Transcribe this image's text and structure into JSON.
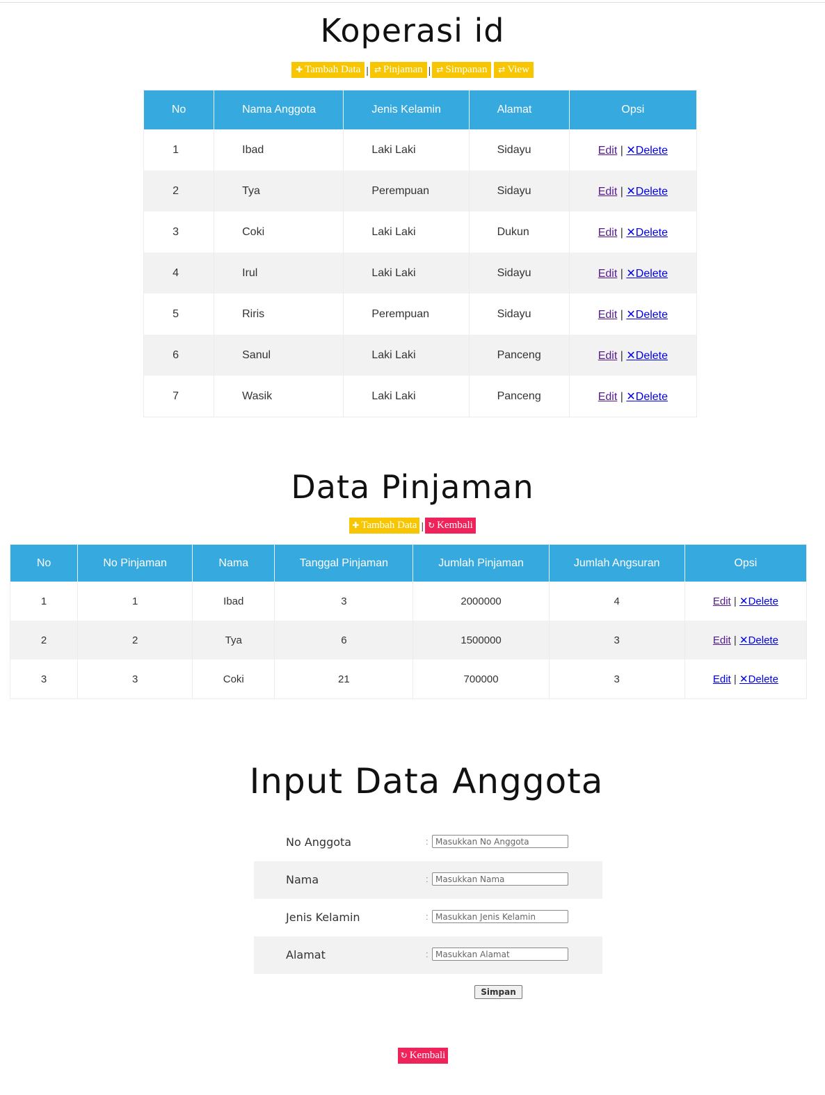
{
  "anggota_section": {
    "title": "Koperasi id",
    "buttons": {
      "tambah": "Tambah Data",
      "pinjaman": "Pinjaman",
      "simpanan": "Simpanan",
      "view": "View"
    },
    "separator": "|",
    "headers": [
      "No",
      "Nama Anggota",
      "Jenis Kelamin",
      "Alamat",
      "Opsi"
    ],
    "rows": [
      {
        "no": "1",
        "nama": "Ibad",
        "jk": "Laki Laki",
        "alamat": "Sidayu"
      },
      {
        "no": "2",
        "nama": "Tya",
        "jk": "Perempuan",
        "alamat": "Sidayu"
      },
      {
        "no": "3",
        "nama": "Coki",
        "jk": "Laki Laki",
        "alamat": "Dukun"
      },
      {
        "no": "4",
        "nama": "Irul",
        "jk": "Laki Laki",
        "alamat": "Sidayu"
      },
      {
        "no": "5",
        "nama": "Riris",
        "jk": "Perempuan",
        "alamat": "Sidayu"
      },
      {
        "no": "6",
        "nama": "Sanul",
        "jk": "Laki Laki",
        "alamat": "Panceng"
      },
      {
        "no": "7",
        "nama": "Wasik",
        "jk": "Laki Laki",
        "alamat": "Panceng"
      }
    ],
    "edit_label": "Edit",
    "delete_label": "Delete"
  },
  "pinjaman_section": {
    "title": "Data Pinjaman",
    "buttons": {
      "tambah": "Tambah Data",
      "kembali": "Kembali"
    },
    "separator": "|",
    "headers": [
      "No",
      "No Pinjaman",
      "Nama",
      "Tanggal Pinjaman",
      "Jumlah Pinjaman",
      "Jumlah Angsuran",
      "Opsi"
    ],
    "rows": [
      {
        "no": "1",
        "no_pinjaman": "1",
        "nama": "Ibad",
        "tanggal": "3",
        "jumlah": "2000000",
        "angsuran": "4"
      },
      {
        "no": "2",
        "no_pinjaman": "2",
        "nama": "Tya",
        "tanggal": "6",
        "jumlah": "1500000",
        "angsuran": "3"
      },
      {
        "no": "3",
        "no_pinjaman": "3",
        "nama": "Coki",
        "tanggal": "21",
        "jumlah": "700000",
        "angsuran": "3"
      }
    ],
    "edit_label": "Edit",
    "delete_label": "Delete"
  },
  "form_section": {
    "title": "Input Data Anggota",
    "fields": [
      {
        "label": "No Anggota",
        "placeholder": "Masukkan No Anggota"
      },
      {
        "label": "Nama",
        "placeholder": "Masukkan Nama"
      },
      {
        "label": "Jenis Kelamin",
        "placeholder": "Masukkan Jenis Kelamin"
      },
      {
        "label": "Alamat",
        "placeholder": "Masukkan Alamat"
      }
    ],
    "colon": ":",
    "submit_label": "Simpan",
    "kembali_label": "Kembali"
  },
  "icons": {
    "plus": "plus-icon",
    "transfer": "transfer-icon",
    "refresh": "refresh-icon",
    "close": "close-icon"
  },
  "colors": {
    "header_blue": "#36a9de",
    "button_yellow": "#f7c600",
    "button_red": "#f0225a",
    "row_alt": "#f2f2f2"
  }
}
